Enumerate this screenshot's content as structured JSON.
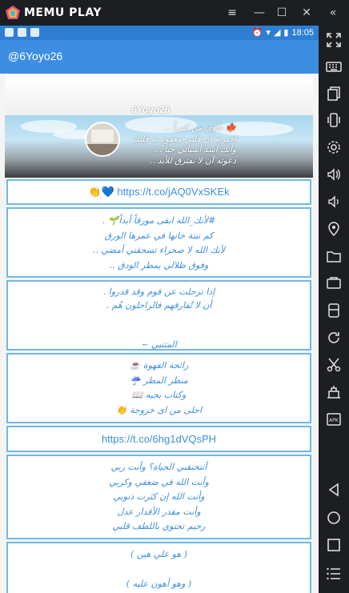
{
  "emulator": {
    "title": "MEMU PLAY",
    "controls": [
      "menu-icon",
      "minimize-icon",
      "maximize-icon",
      "close-icon",
      "collapse-icon"
    ]
  },
  "statusbar": {
    "time": "18:05"
  },
  "appbar": {
    "title": "@6Yoyo26"
  },
  "profile": {
    "name": "6Yoyo26",
    "bio_lines": [
      "🍁 عادي من كثيراً ..",
      "اخبرته أن قلبي معقود به قلبك",
      "وأنك أشد أشيائي حباً ...",
      "دعوته أن لا نفترق للأبد .."
    ]
  },
  "posts": [
    {
      "type": "link",
      "prefix": "👏💙",
      "text": "https://t.co/jAQ0VxSKEk"
    },
    {
      "type": "text",
      "lines": [
        "#لأنك_الله ابقى مورقاً أبداً🌱 .",
        "كم نبتة خانها في عمرها الورق",
        "لأنك الله لا صحراء تسحقني أمضي ..",
        "وفوق ظلالي يمطر الودق .."
      ]
    },
    {
      "type": "text",
      "lines": [
        "إذا ترحلت عن قوم وقد قدروا .",
        "أن لا تُفارقهم فالراحلون هُم .",
        "",
        "",
        "المتنبي ~"
      ]
    },
    {
      "type": "text",
      "lines": [
        "رائحة القهوة ☕",
        "منظر المطر ☔",
        "وكتاب بحبه 📖",
        "احلى من اى خروجة 👏"
      ]
    },
    {
      "type": "link",
      "prefix": "",
      "text": "https://t.co/6hg1dVQsPH"
    },
    {
      "type": "text",
      "lines": [
        "أنتخنقني الحياة؟ وأنت ربي",
        "وأنت الله في ضعفي وكربي",
        "وأنت الله إن كثرت ذنوبي",
        "وأنت مقدر الأقدار عدل",
        "رحيم تحتوي باللطف قلبي"
      ]
    },
    {
      "type": "text",
      "lines": [
        "( هو علي هين )",
        "",
        "( وهو أهون عليه )"
      ]
    }
  ],
  "colors": {
    "accent": "#3d8ee3",
    "card_border": "#70b8e6",
    "text_blue": "#3c8fdd"
  },
  "sidebar_icons": [
    "fullscreen-icon",
    "keyboard-icon",
    "multi-window-icon",
    "shake-icon",
    "settings-icon",
    "volume-up-icon",
    "volume-down-icon",
    "location-icon",
    "folder-icon",
    "screenshot-icon",
    "apk-icon",
    "refresh-icon",
    "cut-icon",
    "tools-icon",
    "install-apk-icon",
    "back-icon",
    "home-icon",
    "recents-icon",
    "more-icon"
  ]
}
